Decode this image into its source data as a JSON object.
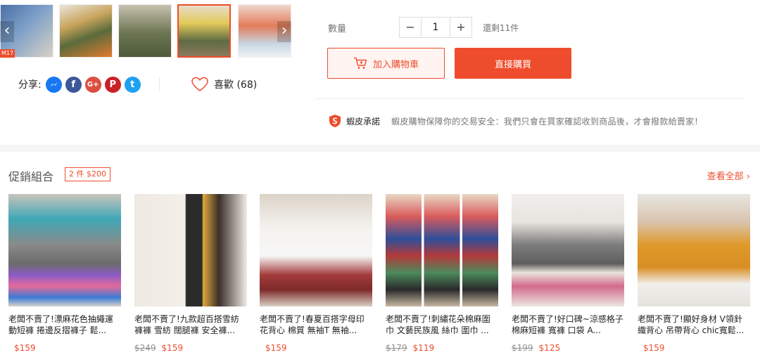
{
  "share": {
    "label": "分享:",
    "icons": [
      {
        "name": "messenger-icon",
        "color": "#1877f2",
        "glyph": "~"
      },
      {
        "name": "facebook-icon",
        "color": "#3b5998",
        "glyph": "f"
      },
      {
        "name": "google-plus-icon",
        "color": "#dc4e41",
        "glyph": "G+"
      },
      {
        "name": "pinterest-icon",
        "color": "#cb2027",
        "glyph": "P"
      },
      {
        "name": "twitter-icon",
        "color": "#1da1f2",
        "glyph": "t"
      }
    ]
  },
  "like": {
    "label": "喜歡 (68)"
  },
  "purchase": {
    "qty_label": "數量",
    "qty_value": "1",
    "minus": "−",
    "plus": "+",
    "stock": "還剩11件",
    "add_to_cart": "加入購物車",
    "buy_now": "直接購買"
  },
  "guarantee": {
    "name": "蝦皮承諾",
    "text": "蝦皮購物保障你的交易安全：我們只會在買家確認收到商品後，才會撥款給賣家！"
  },
  "promo": {
    "title": "促銷組合",
    "tag": "2 件 $200",
    "see_all": "查看全部 ›",
    "items": [
      {
        "name": "老闆不賣了!漂麻花色抽繩運動短褲 捲邊反摺褲子 鬆...",
        "old_price": "",
        "price": "$159"
      },
      {
        "name": "老闆不賣了!九款超百搭雪紡褲褲 雪紡 闊腿褲 安全褲...",
        "old_price": "$249",
        "price": "$159"
      },
      {
        "name": "老闆不賣了!春夏百搭字母印花背心 棉質 無袖T 無袖...",
        "old_price": "",
        "price": "$159"
      },
      {
        "name": "老闆不賣了!刺繡花朵棉麻圍巾 文藝民族風 絲巾 圍巾 ...",
        "old_price": "$179",
        "price": "$119"
      },
      {
        "name": "老闆不賣了!好口碑~涼感格子棉麻短褲 寬褲 口袋 A...",
        "old_price": "$199",
        "price": "$125"
      },
      {
        "name": "老闆不賣了!顯好身材 V領針織背心 吊帶背心 chic寬鬆...",
        "old_price": "",
        "price": "$159"
      }
    ]
  },
  "colors": {
    "accent": "#ee4d2d"
  }
}
